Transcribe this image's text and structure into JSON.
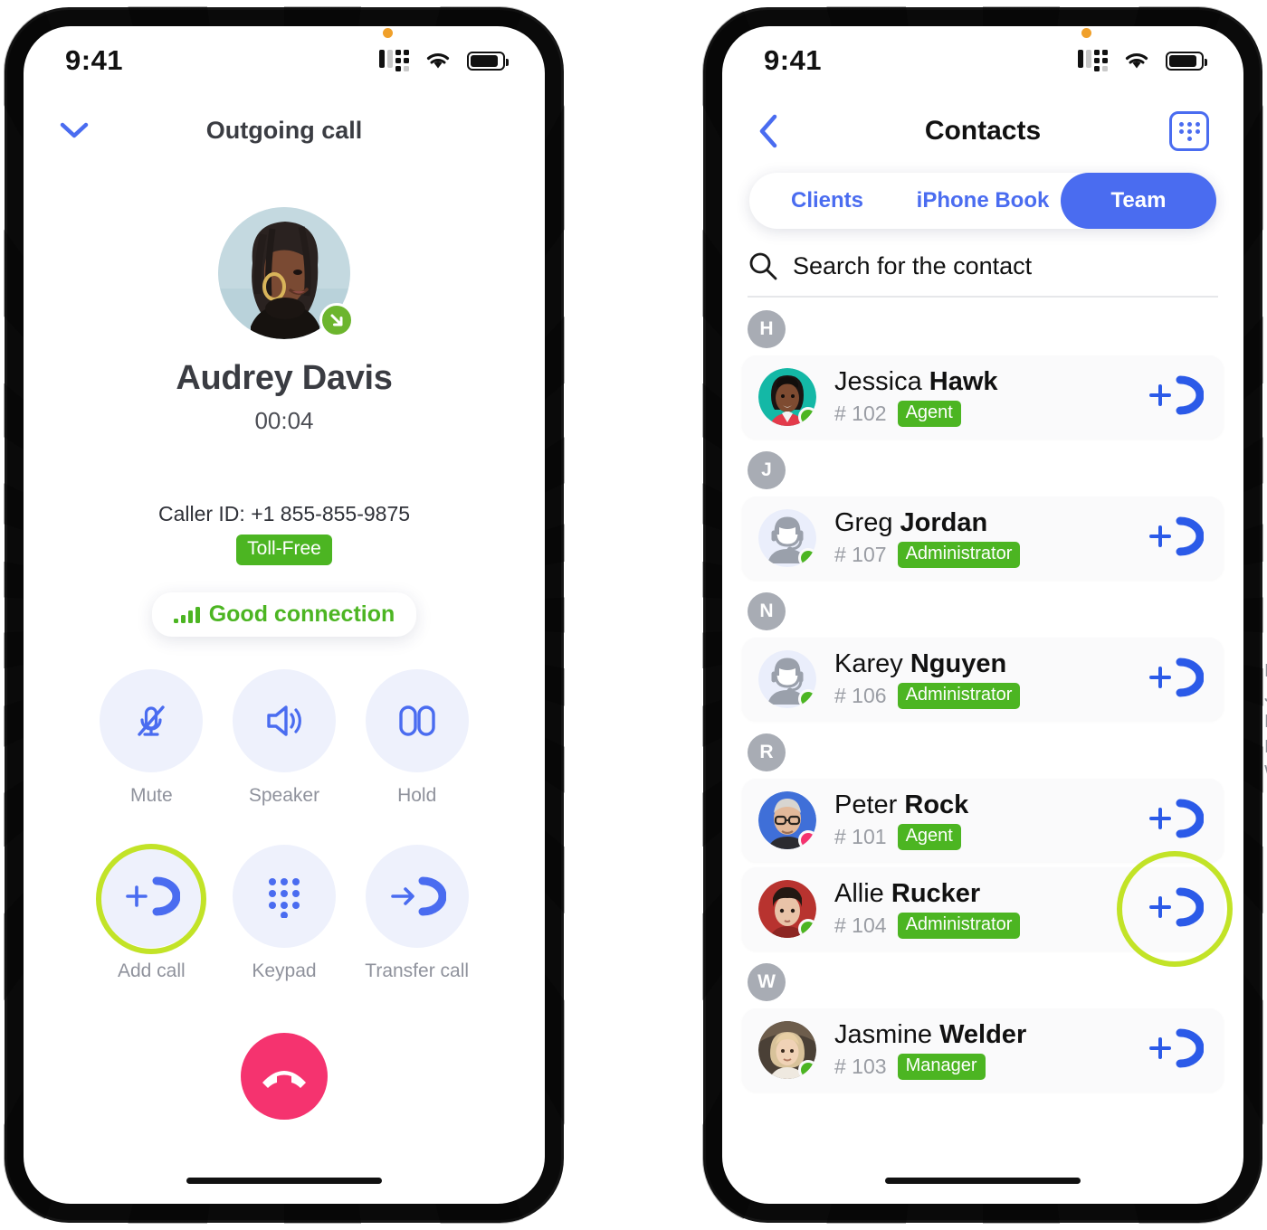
{
  "statusbar": {
    "time": "9:41",
    "signal_icon": "cellular-signal-icon",
    "wifi_icon": "wifi-icon",
    "battery_icon": "battery-icon"
  },
  "call_screen": {
    "collapse_icon": "chevron-down-icon",
    "title": "Outgoing call",
    "avatar_name": "audrey-davis-avatar",
    "outgoing_badge_icon": "outgoing-call-arrow-icon",
    "callee_name": "Audrey Davis",
    "timer": "00:04",
    "caller_id": "Caller ID: +1 855-855-9875",
    "tollfree_badge": "Toll-Free",
    "connection": {
      "icon": "signal-bars-icon",
      "text": "Good connection"
    },
    "controls": [
      {
        "label": "Mute",
        "icon": "mic-muted-icon",
        "highlighted": false
      },
      {
        "label": "Speaker",
        "icon": "speaker-icon",
        "highlighted": false
      },
      {
        "label": "Hold",
        "icon": "hold-icon",
        "highlighted": false
      },
      {
        "label": "Add call",
        "icon": "add-call-icon",
        "highlighted": true
      },
      {
        "label": "Keypad",
        "icon": "keypad-icon",
        "highlighted": false
      },
      {
        "label": "Transfer call",
        "icon": "transfer-call-icon",
        "highlighted": false
      }
    ],
    "end_call_icon": "end-call-icon"
  },
  "contacts_screen": {
    "back_icon": "chevron-left-icon",
    "title": "Contacts",
    "dialpad_icon": "dialpad-icon",
    "tabs": [
      {
        "label": "Clients",
        "active": false
      },
      {
        "label": "iPhone Book",
        "active": false
      },
      {
        "label": "Team",
        "active": true
      }
    ],
    "search": {
      "icon": "search-icon",
      "placeholder": "Search for the contact",
      "value": ""
    },
    "sections": [
      {
        "letter": "H",
        "contacts": [
          {
            "first": "Jessica",
            "last": "Hawk",
            "ext": "# 102",
            "role": "Agent",
            "avatar": "jessica-hawk-avatar",
            "avatar_bg": "#14b8a6",
            "status": "online",
            "status_color": "#4cb522",
            "action_icon": "add-call-icon",
            "highlighted": false
          }
        ]
      },
      {
        "letter": "J",
        "contacts": [
          {
            "first": "Greg",
            "last": "Jordan",
            "ext": "# 107",
            "role": "Administrator",
            "avatar": "placeholder-agent-avatar",
            "avatar_bg": "#eaeefb",
            "status": "online",
            "status_color": "#4cb522",
            "action_icon": "add-call-icon",
            "highlighted": false
          }
        ]
      },
      {
        "letter": "N",
        "contacts": [
          {
            "first": "Karey",
            "last": "Nguyen",
            "ext": "# 106",
            "role": "Administrator",
            "avatar": "placeholder-agent-avatar",
            "avatar_bg": "#eaeefb",
            "status": "online",
            "status_color": "#4cb522",
            "action_icon": "add-call-icon",
            "highlighted": false
          }
        ]
      },
      {
        "letter": "R",
        "contacts": [
          {
            "first": "Peter",
            "last": "Rock",
            "ext": "# 101",
            "role": "Agent",
            "avatar": "peter-rock-avatar",
            "avatar_bg": "#3f6fd8",
            "status": "busy",
            "status_color": "#f5336f",
            "action_icon": "add-call-icon",
            "highlighted": false
          },
          {
            "first": "Allie",
            "last": "Rucker",
            "ext": "# 104",
            "role": "Administrator",
            "avatar": "allie-rucker-avatar",
            "avatar_bg": "#b8332f",
            "status": "online",
            "status_color": "#4cb522",
            "action_icon": "add-call-icon",
            "highlighted": true
          }
        ]
      },
      {
        "letter": "W",
        "contacts": [
          {
            "first": "Jasmine",
            "last": "Welder",
            "ext": "# 103",
            "role": "Manager",
            "avatar": "jasmine-welder-avatar",
            "avatar_bg": "#c9a87c",
            "status": "online",
            "status_color": "#4cb522",
            "action_icon": "add-call-icon",
            "highlighted": false
          }
        ]
      }
    ],
    "alpha_index": [
      "H",
      "J",
      "N",
      "R",
      "W"
    ]
  },
  "colors": {
    "accent_blue": "#4a6cf0",
    "green": "#4cb522",
    "pink": "#f5336f",
    "highlight_ring": "#c2e327",
    "control_bg": "#eef1fc"
  }
}
